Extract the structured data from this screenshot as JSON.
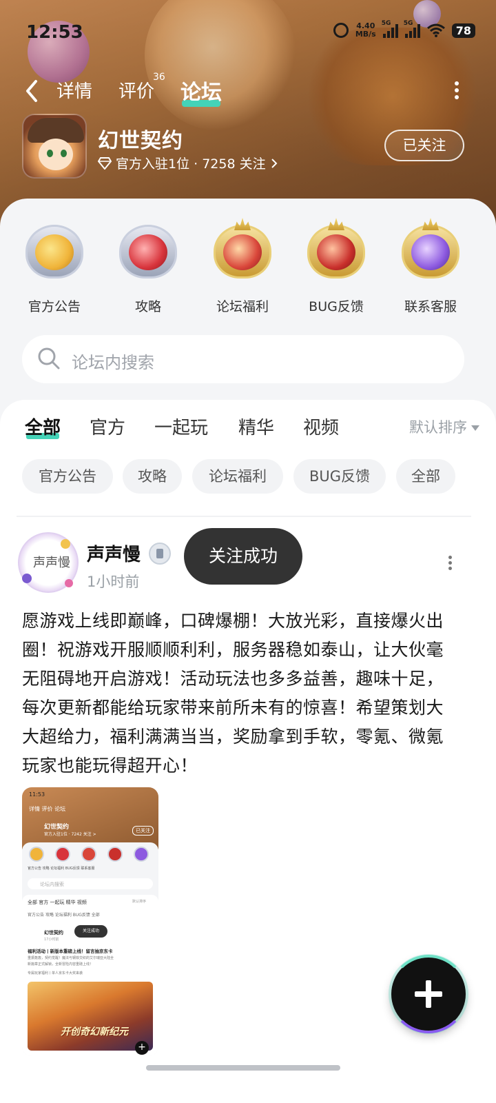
{
  "status_bar": {
    "time": "12:53",
    "net_speed": "4.40",
    "net_unit": "MB/s",
    "signal1": "5G",
    "signal2": "5G",
    "battery": "78"
  },
  "nav": {
    "tabs": [
      {
        "label": "详情"
      },
      {
        "label": "评价"
      },
      {
        "label": "论坛"
      }
    ],
    "review_count": "36",
    "active_tab": "论坛"
  },
  "game": {
    "title": "幻世契约",
    "meta": "官方入驻1位 · 7258 关注",
    "follow_label": "已关注"
  },
  "categories": [
    {
      "label": "官方公告",
      "color": "#f0b43a"
    },
    {
      "label": "攻略",
      "color": "#d8343c"
    },
    {
      "label": "论坛福利",
      "color": "#d9463a"
    },
    {
      "label": "BUG反馈",
      "color": "#c9302c"
    },
    {
      "label": "联系客服",
      "color": "#8d5ae0"
    }
  ],
  "search": {
    "placeholder": "论坛内搜索"
  },
  "filters": {
    "items": [
      {
        "label": "全部"
      },
      {
        "label": "官方"
      },
      {
        "label": "一起玩"
      },
      {
        "label": "精华"
      },
      {
        "label": "视频"
      }
    ],
    "sort_label": "默认排序"
  },
  "chips": [
    {
      "label": "官方公告"
    },
    {
      "label": "攻略"
    },
    {
      "label": "论坛福利"
    },
    {
      "label": "BUG反馈"
    },
    {
      "label": "全部"
    }
  ],
  "post": {
    "avatar_text": "声声慢",
    "author": "声声慢",
    "time": "1小时前",
    "toast": "关注成功",
    "body": "愿游戏上线即巅峰，口碑爆棚！大放光彩，直接爆火出圈！祝游戏开服顺顺利利，服务器稳如泰山，让大伙毫无阻碍地开启游戏！活动玩法也多多益善，趣味十足，每次更新都能给玩家带来前所未有的惊喜！希望策划大大超给力，福利满满当当，奖励拿到手软，零氪、微氪玩家也能玩得超开心！"
  },
  "thumbnail": {
    "time": "11:53",
    "tabs": "详情 评价 论坛",
    "game_title": "幻世契约",
    "follow_label": "已关注",
    "meta": "官方入驻1位 · 7242 关注 >",
    "icon_labels": "官方公告   攻略   论坛福利   BUG反馈   联系客服",
    "search": "论坛内搜索",
    "filters": "全部   官方   一起玩   精华   视频",
    "sort": "默认排序",
    "chips": "官方公告  攻略  论坛福利  BUG反馈  全部",
    "post_author": "幻世契约",
    "post_time": "17小时前",
    "toast": "关注成功",
    "post_title": "福利活动丨新版本重磅上线！留言抽京东卡",
    "post_line1": "重振轰轰，契约觉醒！魔法与钢铁交织的艾尔瑞亚大陆全",
    "post_line2": "新篇章正式解锁，全新冒险内容重磅上线！",
    "post_line3": "专属玩家福利丨单人京东卡大奖来袭",
    "art_logo": "开创奇幻新纪元"
  }
}
